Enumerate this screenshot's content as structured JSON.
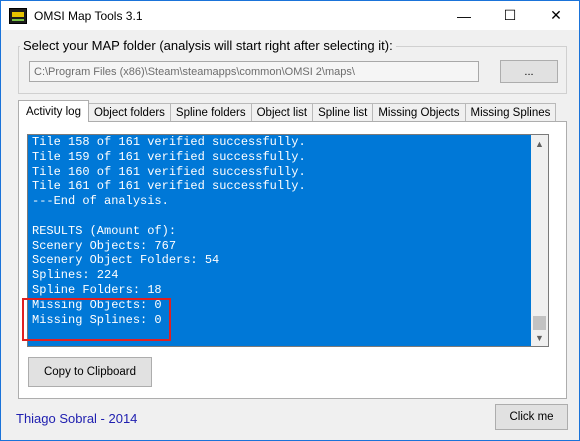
{
  "window": {
    "title": "OMSI Map Tools 3.1",
    "controls": {
      "minimize": "—",
      "maximize": "☐",
      "close": "✕"
    }
  },
  "folder_group": {
    "legend": "Select your MAP folder (analysis will start right after selecting it):",
    "path_value": "C:\\Program Files (x86)\\Steam\\steamapps\\common\\OMSI 2\\maps\\",
    "browse_label": "..."
  },
  "tabs": [
    {
      "label": "Activity log",
      "active": true
    },
    {
      "label": "Object folders",
      "active": false
    },
    {
      "label": "Spline folders",
      "active": false
    },
    {
      "label": "Object list",
      "active": false
    },
    {
      "label": "Spline list",
      "active": false
    },
    {
      "label": "Missing Objects",
      "active": false
    },
    {
      "label": "Missing Splines",
      "active": false
    }
  ],
  "log": {
    "lines": [
      "Tile 158 of 161 verified successfully.",
      "Tile 159 of 161 verified successfully.",
      "Tile 160 of 161 verified successfully.",
      "Tile 161 of 161 verified successfully.",
      "---End of analysis.",
      "",
      "RESULTS (Amount of):",
      "Scenery Objects: 767",
      "Scenery Object Folders: 54",
      "Splines: 224",
      "Spline Folders: 18",
      "Missing Objects: 0",
      "Missing Splines: 0"
    ],
    "background_color": "#0078d7"
  },
  "buttons": {
    "copy": "Copy to Clipboard",
    "clickme": "Click me"
  },
  "footer": {
    "credit": "Thiago Sobral - 2014"
  },
  "colors": {
    "highlight_border": "#e02020",
    "credit_text": "#2020b0"
  }
}
